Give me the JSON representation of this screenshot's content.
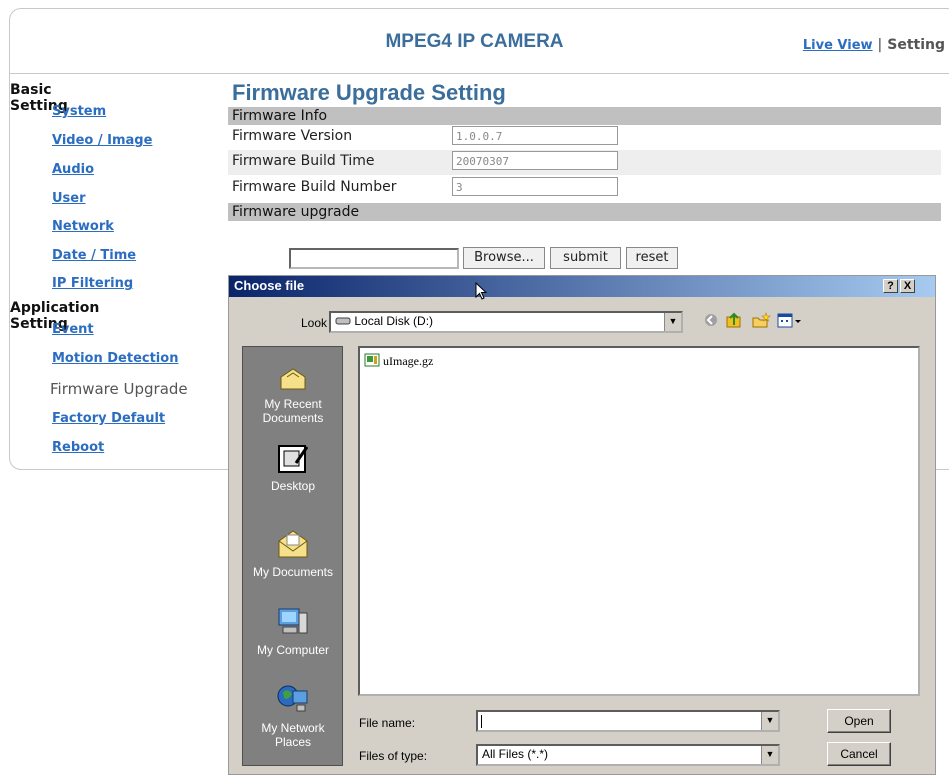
{
  "header": {
    "title": "MPEG4 IP CAMERA",
    "live_view": "Live View",
    "separator": "|",
    "setting": "Setting"
  },
  "sidebar": {
    "basic_heading": "Basic Setting",
    "basic_items": [
      "System",
      "Video / Image",
      "Audio",
      "User",
      "Network",
      "Date / Time",
      "IP Filtering"
    ],
    "app_heading": "Application Setting",
    "app_items": [
      "Event",
      "Motion Detection"
    ],
    "current": "Firmware Upgrade",
    "more_items": [
      "Factory Default",
      "Reboot"
    ]
  },
  "main": {
    "page_title": "Firmware Upgrade Setting",
    "info_bar": "Firmware Info",
    "rows": [
      {
        "label": "Firmware Version",
        "value": "1.0.0.7"
      },
      {
        "label": "Firmware Build Time",
        "value": "20070307"
      },
      {
        "label": "Firmware Build Number",
        "value": "3"
      }
    ],
    "upgrade_bar": "Firmware upgrade",
    "browse_label": "Browse...",
    "submit_label": "submit",
    "reset_label": "reset"
  },
  "dialog": {
    "title": "Choose file",
    "help_btn": "?",
    "close_btn": "X",
    "look_in_label": "Look in:",
    "look_in_value": "Local Disk (D:)",
    "places": [
      "My Recent Documents",
      "Desktop",
      "My Documents",
      "My Computer",
      "My Network Places"
    ],
    "files": [
      "uImage.gz"
    ],
    "file_name_label": "File name:",
    "file_name_value": "",
    "file_type_label": "Files of type:",
    "file_type_value": "All Files (*.*)",
    "open_label": "Open",
    "cancel_label": "Cancel"
  }
}
